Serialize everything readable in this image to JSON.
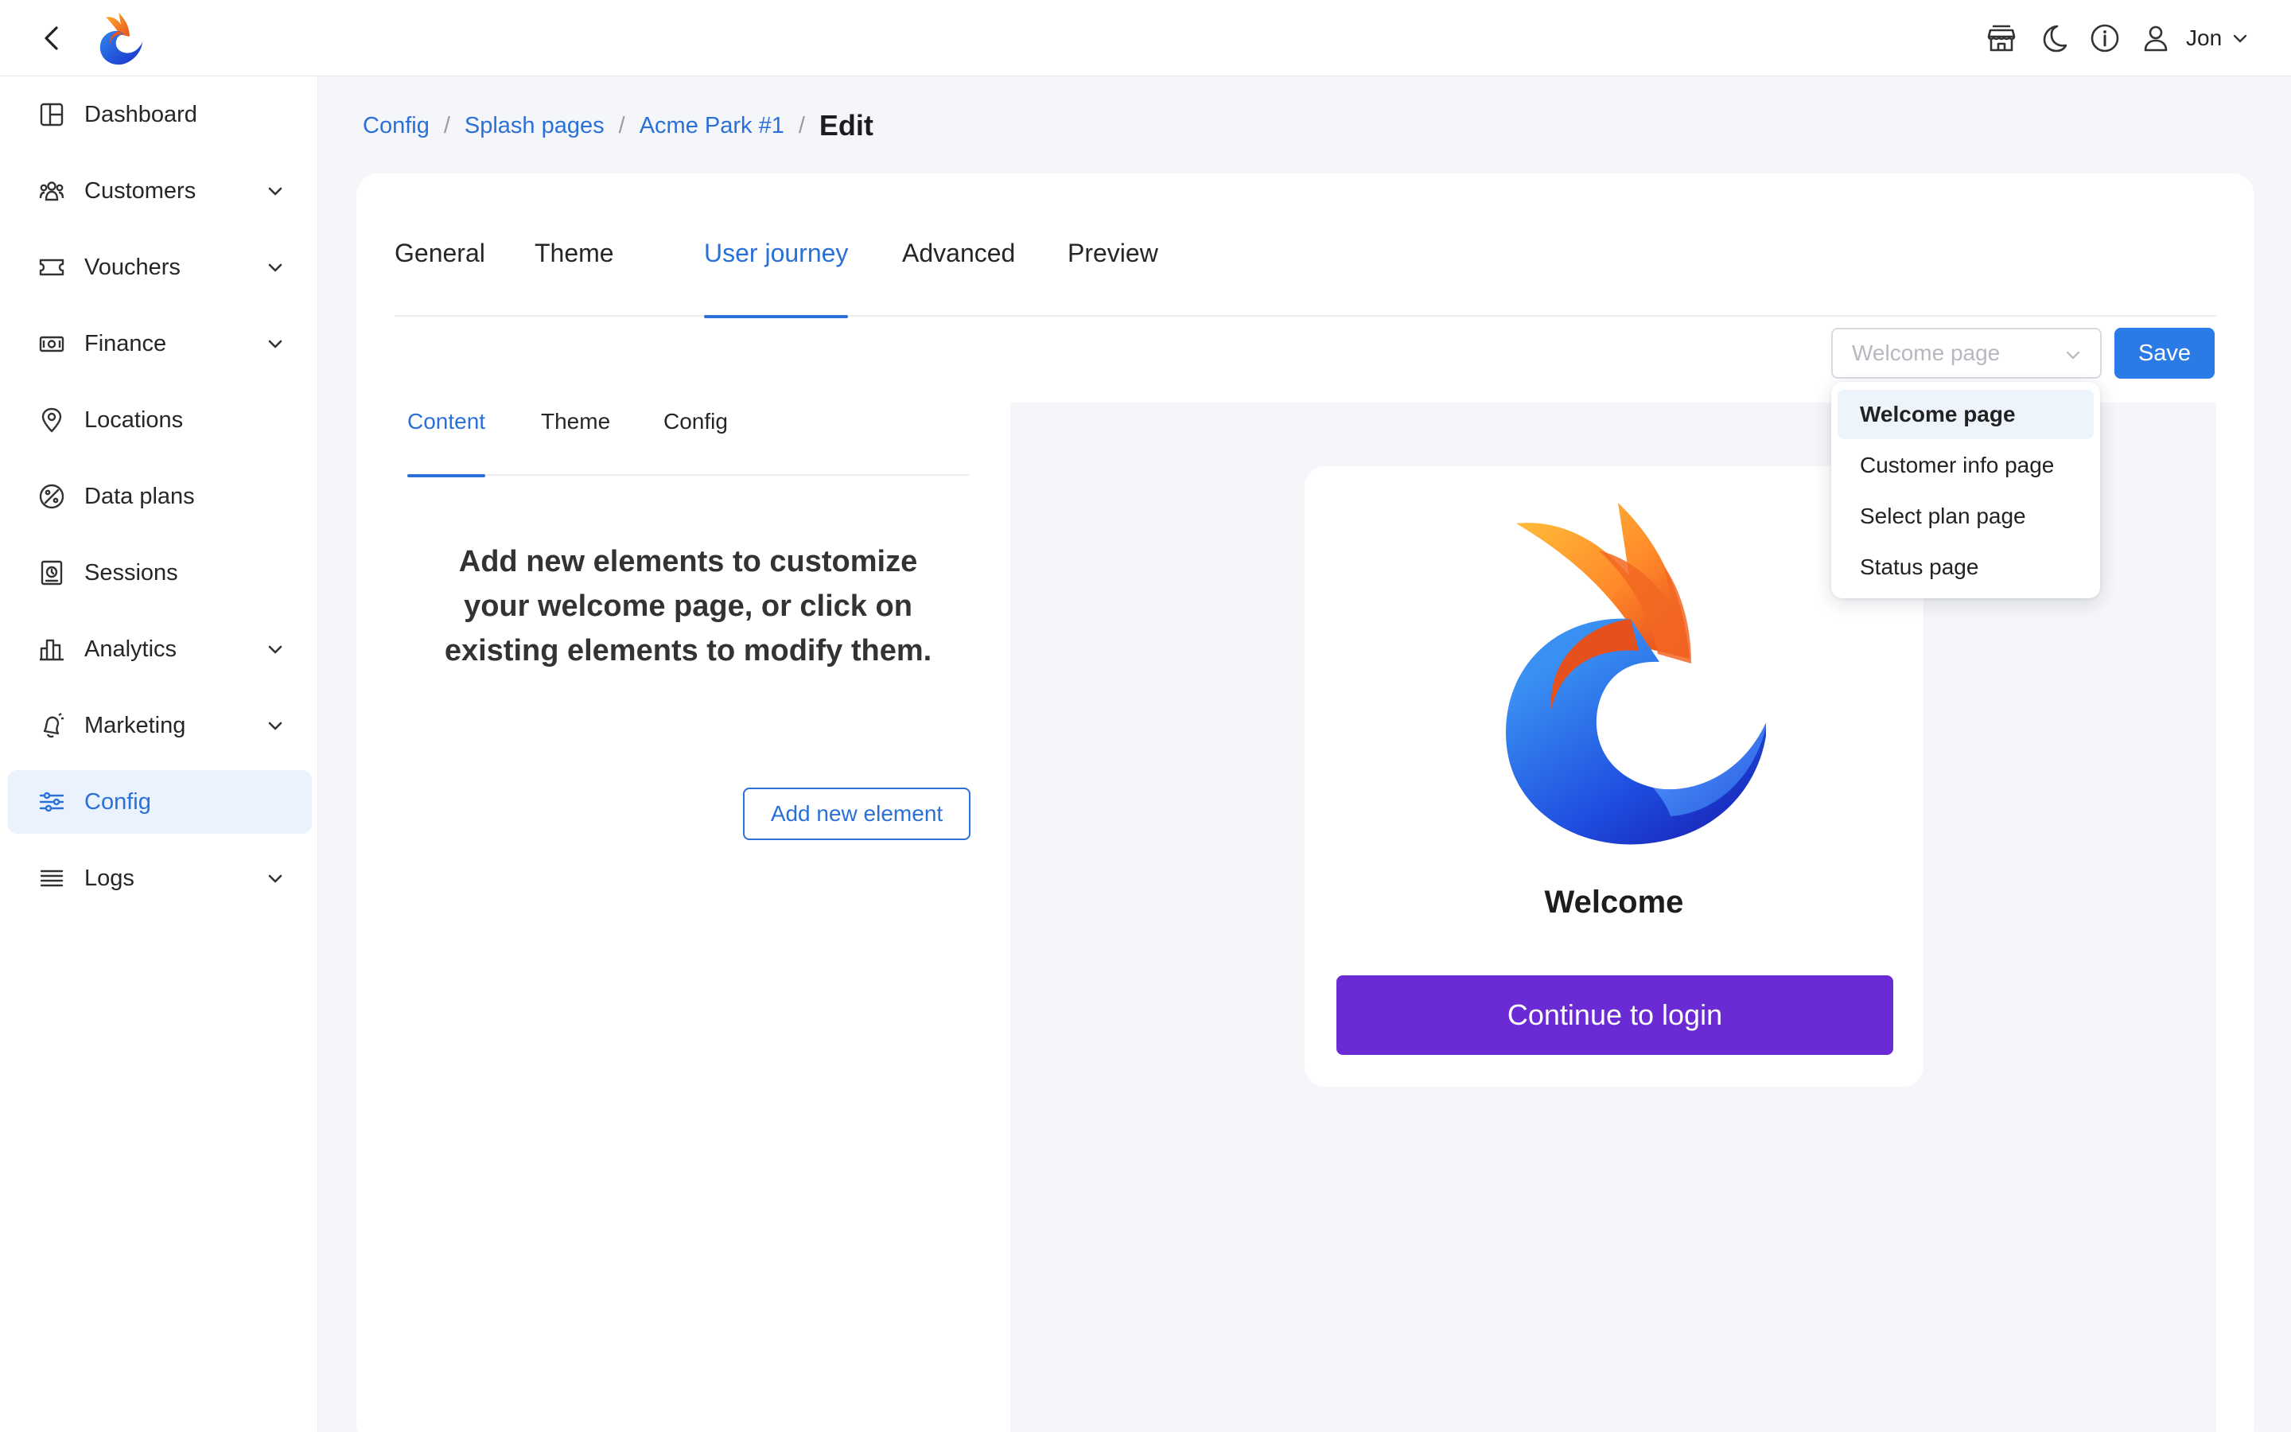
{
  "topbar": {
    "user_name": "Jon",
    "icons": [
      "back-icon",
      "app-logo",
      "store-icon",
      "moon-icon",
      "info-icon",
      "user-icon",
      "chevron-down-icon"
    ]
  },
  "sidebar": {
    "items": [
      {
        "label": "Dashboard",
        "icon": "dashboard-icon",
        "has_children": false
      },
      {
        "label": "Customers",
        "icon": "customers-icon",
        "has_children": true
      },
      {
        "label": "Vouchers",
        "icon": "ticket-icon",
        "has_children": true
      },
      {
        "label": "Finance",
        "icon": "money-icon",
        "has_children": true
      },
      {
        "label": "Locations",
        "icon": "location-pin-icon",
        "has_children": false
      },
      {
        "label": "Data plans",
        "icon": "data-plan-icon",
        "has_children": false
      },
      {
        "label": "Sessions",
        "icon": "sessions-icon",
        "has_children": false
      },
      {
        "label": "Analytics",
        "icon": "bar-chart-icon",
        "has_children": true
      },
      {
        "label": "Marketing",
        "icon": "bell-icon",
        "has_children": true
      },
      {
        "label": "Config",
        "icon": "sliders-icon",
        "has_children": false,
        "active": true
      },
      {
        "label": "Logs",
        "icon": "list-icon",
        "has_children": true
      }
    ]
  },
  "breadcrumb": {
    "items": [
      "Config",
      "Splash pages",
      "Acme Park #1"
    ],
    "separator": "/",
    "current": "Edit"
  },
  "tabs": {
    "items": [
      "General",
      "Theme",
      "User journey",
      "Advanced",
      "Preview"
    ],
    "active": "User journey"
  },
  "page_select": {
    "placeholder": "Welcome page",
    "options": [
      "Welcome page",
      "Customer info page",
      "Select plan page",
      "Status page"
    ],
    "selected": "Welcome page"
  },
  "save_label": "Save",
  "editor": {
    "subtabs": [
      "Content",
      "Theme",
      "Config"
    ],
    "active_subtab": "Content",
    "hint": "Add new elements to customize your welcome page, or click on existing elements to modify them.",
    "add_button_label": "Add new element"
  },
  "preview": {
    "title": "Welcome",
    "cta_label": "Continue to login",
    "cta_color": "#6a2bd4"
  },
  "colors": {
    "accent": "#2b6fd9",
    "save_button": "#2b7be6",
    "active_nav_bg": "#e9f2fd",
    "canvas_bg": "#f5f6f9"
  }
}
